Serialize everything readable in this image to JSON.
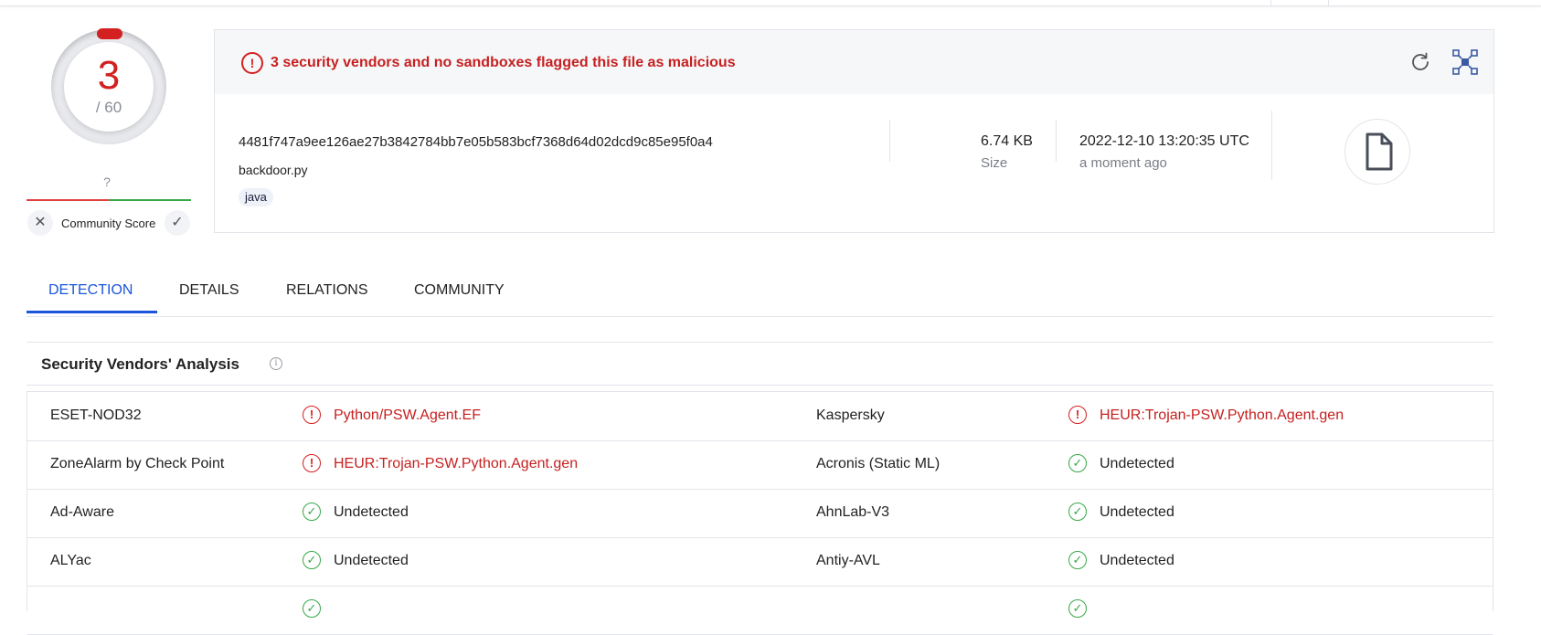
{
  "score": {
    "detections": "3",
    "total": "/ 60"
  },
  "community": {
    "unknown": "?",
    "label": "Community Score"
  },
  "alert": {
    "text": "3 security vendors and no sandboxes flagged this file as malicious"
  },
  "file": {
    "hash": "4481f747a9ee126ae27b3842784bb7e05b583bcf7368d64d02dcd9c85e95f0a4",
    "name": "backdoor.py",
    "tag": "java",
    "size": "6.74 KB",
    "size_label": "Size",
    "date": "2022-12-10 13:20:35 UTC",
    "date_relative": "a moment ago"
  },
  "tabs": [
    {
      "label": "DETECTION"
    },
    {
      "label": "DETAILS"
    },
    {
      "label": "RELATIONS"
    },
    {
      "label": "COMMUNITY"
    }
  ],
  "analysis": {
    "title": "Security Vendors' Analysis",
    "rows": [
      {
        "left_vendor": "ESET-NOD32",
        "left_result": "Python/PSW.Agent.EF",
        "right_vendor": "Kaspersky",
        "right_result": "HEUR:Trojan-PSW.Python.Agent.gen"
      },
      {
        "left_vendor": "ZoneAlarm by Check Point",
        "left_result": "HEUR:Trojan-PSW.Python.Agent.gen",
        "right_vendor": "Acronis (Static ML)",
        "right_result": "Undetected"
      },
      {
        "left_vendor": "Ad-Aware",
        "left_result": "Undetected",
        "right_vendor": "AhnLab-V3",
        "right_result": "Undetected"
      },
      {
        "left_vendor": "ALYac",
        "left_result": "Undetected",
        "right_vendor": "Antiy-AVL",
        "right_result": "Undetected"
      }
    ]
  },
  "colors": {
    "malicious": "#d32020",
    "clean": "#37a846",
    "accent": "#1a56db"
  },
  "icons": {
    "alert": "exclamation-circle-icon",
    "refresh": "refresh-icon",
    "graph": "graph-icon",
    "file": "file-icon",
    "info": "info-icon",
    "detected": "exclamation-circle-icon",
    "undetected": "check-circle-icon"
  }
}
